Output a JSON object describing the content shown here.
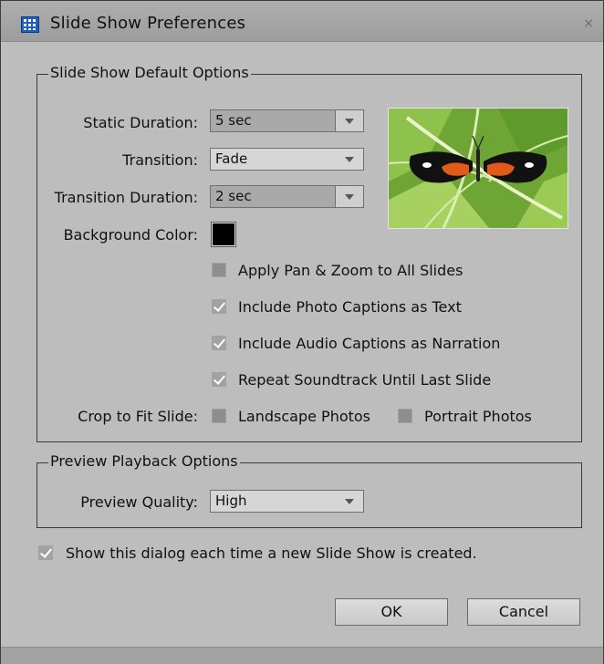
{
  "window": {
    "title": "Slide Show Preferences",
    "close_glyph": "×",
    "icon": "grid-app-icon"
  },
  "default_options": {
    "legend": "Slide Show Default Options",
    "static_duration": {
      "label": "Static Duration:",
      "value": "5 sec"
    },
    "transition": {
      "label": "Transition:",
      "value": "Fade"
    },
    "transition_duration": {
      "label": "Transition Duration:",
      "value": "2 sec"
    },
    "background_color": {
      "label": "Background Color:",
      "value": "#000000"
    },
    "checkboxes": [
      {
        "label": "Apply Pan & Zoom to All Slides",
        "checked": false
      },
      {
        "label": "Include Photo Captions as Text",
        "checked": true
      },
      {
        "label": "Include Audio Captions as Narration",
        "checked": true
      },
      {
        "label": "Repeat Soundtrack Until Last Slide",
        "checked": true
      }
    ],
    "crop": {
      "label": "Crop to Fit Slide:",
      "landscape": {
        "label": "Landscape Photos",
        "checked": false
      },
      "portrait": {
        "label": "Portrait Photos",
        "checked": false
      }
    },
    "preview_image": "butterfly-on-leaf-photo"
  },
  "playback_options": {
    "legend": "Preview Playback Options",
    "quality": {
      "label": "Preview Quality:",
      "value": "High"
    }
  },
  "show_dialog": {
    "label": "Show this dialog each time a new Slide Show is created.",
    "checked": true
  },
  "buttons": {
    "ok": "OK",
    "cancel": "Cancel"
  }
}
